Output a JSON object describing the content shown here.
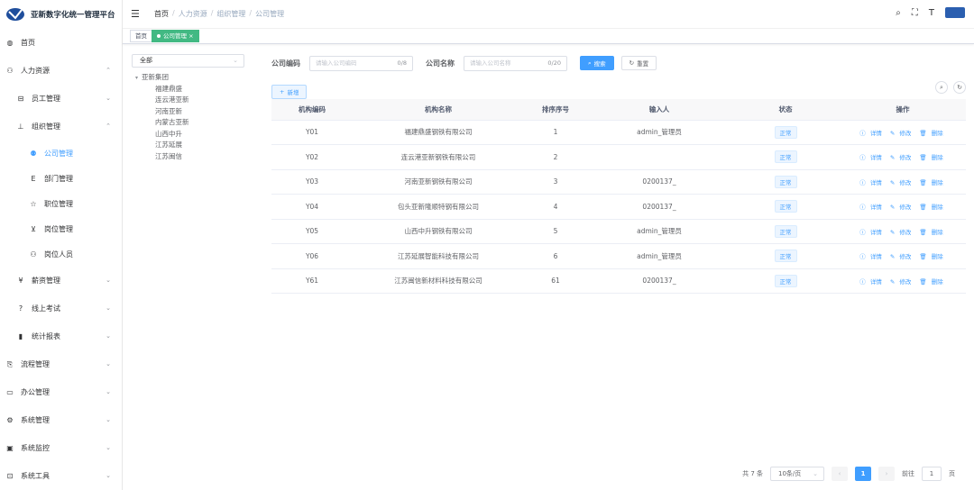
{
  "app": {
    "title": "亚新数字化统一管理平台"
  },
  "sidebar": {
    "items": [
      {
        "label": "首页",
        "icon": "dashboard-icon"
      },
      {
        "label": "人力资源",
        "icon": "people-icon"
      },
      {
        "label": "员工管理",
        "icon": "chair-icon"
      },
      {
        "label": "组织管理",
        "icon": "org-tree-icon"
      },
      {
        "label": "公司管理",
        "icon": "company-icon"
      },
      {
        "label": "部门管理",
        "icon": "dept-icon"
      },
      {
        "label": "职位管理",
        "icon": "star-icon"
      },
      {
        "label": "岗位管理",
        "icon": "post-icon"
      },
      {
        "label": "岗位人员",
        "icon": "people-icon"
      },
      {
        "label": "薪资管理",
        "icon": "yen-icon"
      },
      {
        "label": "线上考试",
        "icon": "question-icon"
      },
      {
        "label": "统计报表",
        "icon": "bar-chart-icon"
      },
      {
        "label": "流程管理",
        "icon": "flow-icon"
      },
      {
        "label": "办公管理",
        "icon": "office-icon"
      },
      {
        "label": "系统管理",
        "icon": "gear-icon"
      },
      {
        "label": "系统监控",
        "icon": "monitor-icon"
      },
      {
        "label": "系统工具",
        "icon": "tool-icon"
      }
    ]
  },
  "breadcrumb": [
    "首页",
    "人力资源",
    "组织管理",
    "公司管理"
  ],
  "tags": [
    "首页",
    "公司管理"
  ],
  "tree": {
    "select_value": "全部",
    "root": "亚新集团",
    "children": [
      "福建鼎盛",
      "连云港亚新",
      "河南亚新",
      "内蒙古亚新",
      "山西中升",
      "江苏延展",
      "江苏闽信"
    ]
  },
  "search": {
    "code_label": "公司编码",
    "code_placeholder": "请输入公司编码",
    "code_count": "0/8",
    "name_label": "公司名称",
    "name_placeholder": "请输入公司名称",
    "name_count": "0/20",
    "search_btn": "搜索",
    "reset_btn": "重置",
    "add_btn": "新增"
  },
  "table": {
    "headers": [
      "机构编码",
      "机构名称",
      "排序序号",
      "输入人",
      "状态",
      "操作"
    ],
    "rows": [
      {
        "code": "Y01",
        "name": "福建鼎盛钢铁有限公司",
        "order": "1",
        "user": "admin_管理员",
        "status": "正常"
      },
      {
        "code": "Y02",
        "name": "连云港亚新钢铁有限公司",
        "order": "2",
        "user": "",
        "status": "正常"
      },
      {
        "code": "Y03",
        "name": "河南亚新钢铁有限公司",
        "order": "3",
        "user": "0200137_",
        "status": "正常"
      },
      {
        "code": "Y04",
        "name": "包头亚新隆顺特钢有限公司",
        "order": "4",
        "user": "0200137_",
        "status": "正常"
      },
      {
        "code": "Y05",
        "name": "山西中升钢铁有限公司",
        "order": "5",
        "user": "admin_管理员",
        "status": "正常"
      },
      {
        "code": "Y06",
        "name": "江苏延展智能科技有限公司",
        "order": "6",
        "user": "admin_管理员",
        "status": "正常"
      },
      {
        "code": "Y61",
        "name": "江苏闽信新材料科技有限公司",
        "order": "61",
        "user": "0200137_",
        "status": "正常"
      }
    ],
    "ops": [
      "详情",
      "修改",
      "删除"
    ]
  },
  "pagination": {
    "total": "共 7 条",
    "size": "10条/页",
    "current": "1",
    "goto": "前往",
    "goto_value": "1",
    "page_unit": "页"
  }
}
